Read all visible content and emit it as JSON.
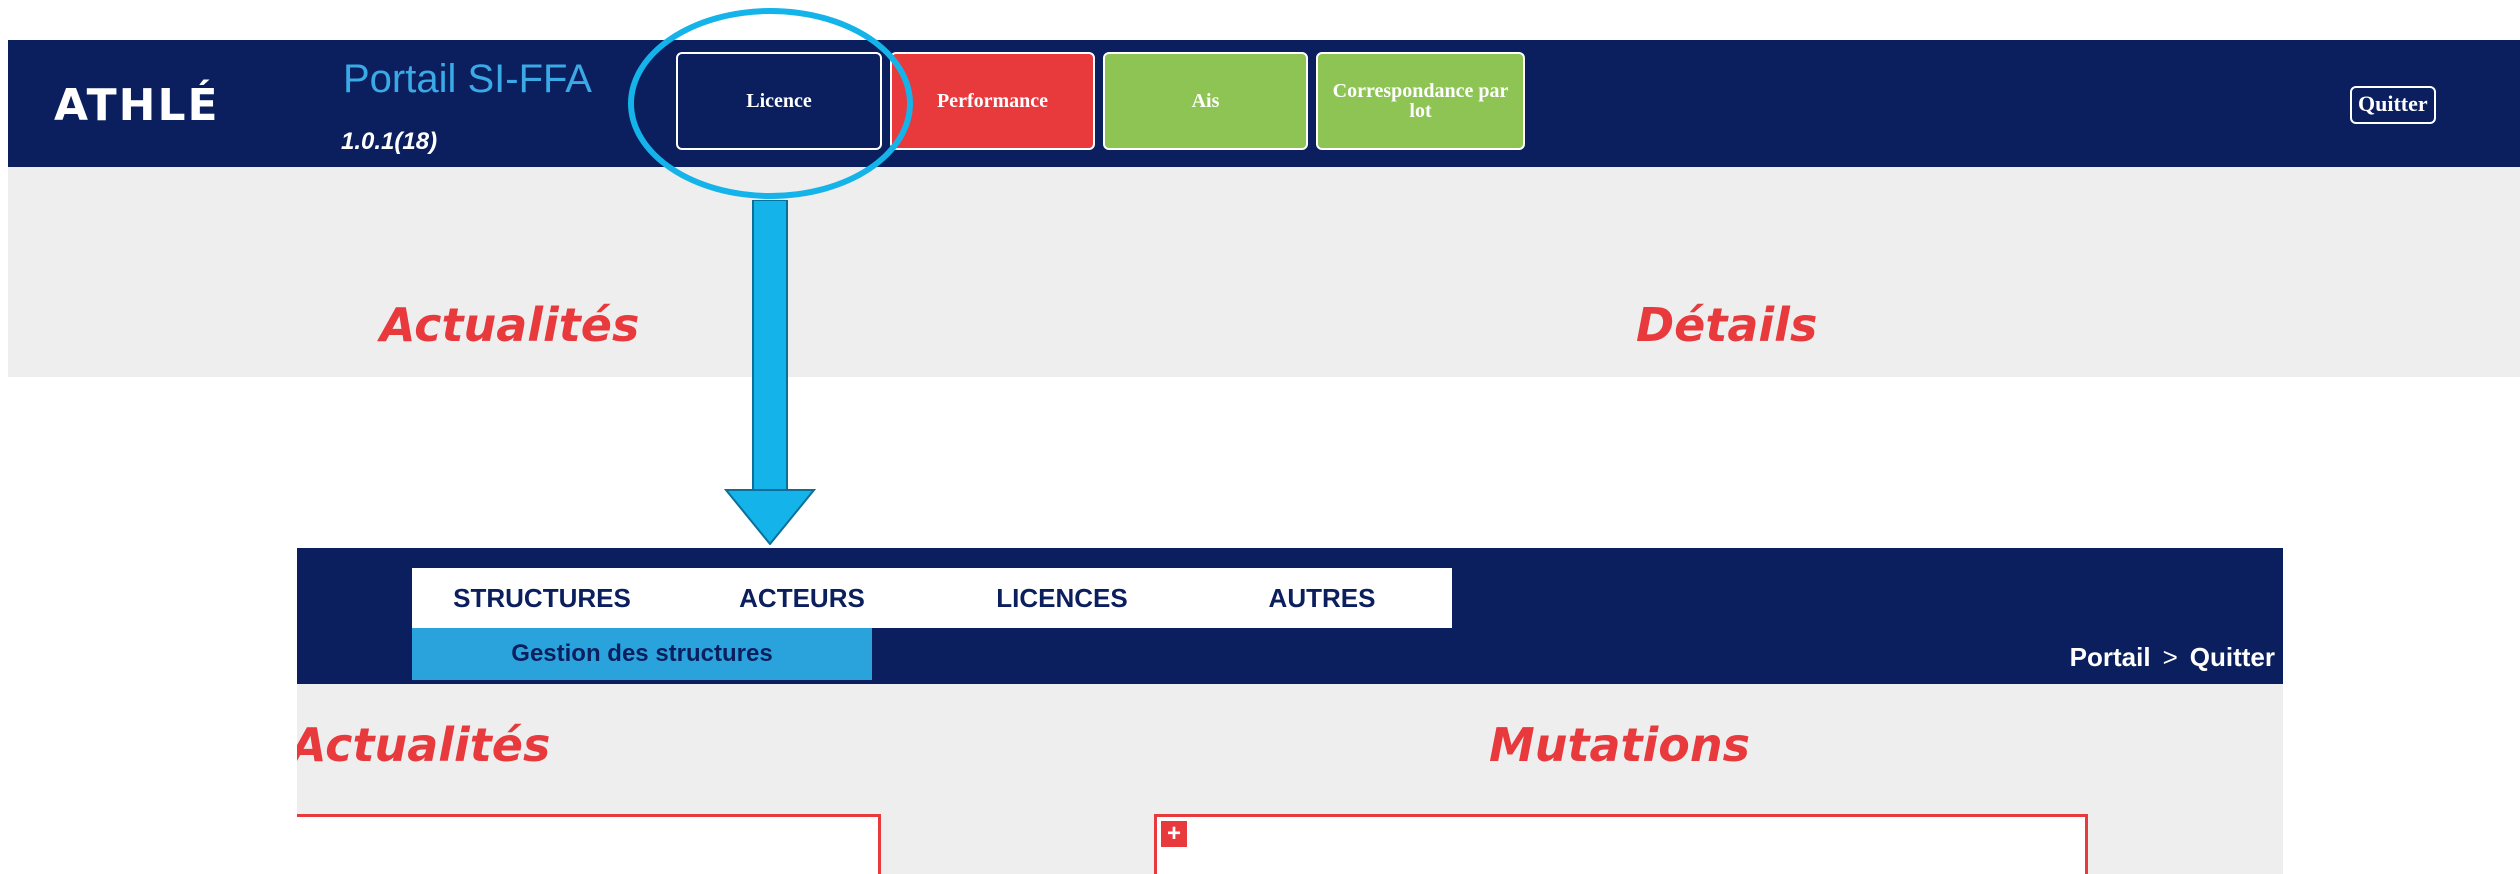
{
  "portal": {
    "logo": "ATHLÉ",
    "title": "Portail SI-FFA",
    "version": "1.0.1(18)",
    "nav": {
      "licence": "Licence",
      "performance": "Performance",
      "ais": "Ais",
      "correspondance": "Correspondance par lot"
    },
    "quit": "Quitter",
    "news_heading": "Actualités",
    "details_heading": "Détails"
  },
  "licence_app": {
    "menu": [
      "STRUCTURES",
      "ACTEURS",
      "LICENCES",
      "AUTRES"
    ],
    "submenu": "Gestion des structures",
    "breadcrumb": {
      "portal": "Portail",
      "separator": ">",
      "quit": "Quitter"
    },
    "news_heading": "Actualités",
    "mutations_heading": "Mutations",
    "expand_symbol": "+"
  },
  "colors": {
    "navy": "#0b1f5e",
    "red": "#e8393d",
    "green": "#8dc453",
    "light_blue": "#2aa3dc",
    "callout_cyan": "#14b4ea"
  }
}
